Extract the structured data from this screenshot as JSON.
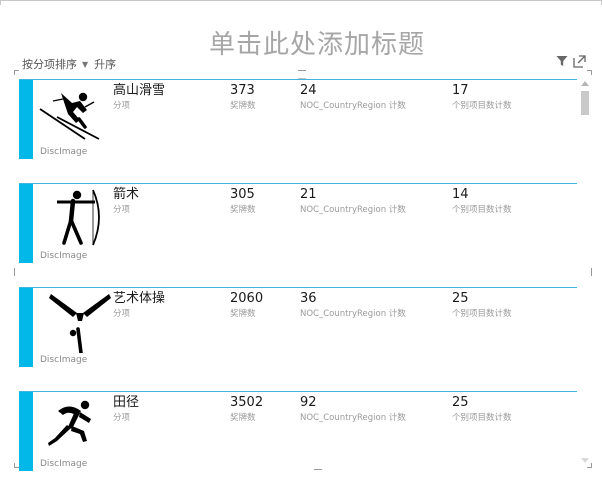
{
  "header": {
    "title": "单击此处添加标题",
    "sort": {
      "label": "按分项排序",
      "order": "升序"
    }
  },
  "icons": {
    "filter": "filter-icon",
    "focus_mode": "focus-mode-icon",
    "accent_color": "#01b8e8"
  },
  "cards": [
    {
      "image_label": "DiscImage",
      "pictogram": "alpine-skiing-icon",
      "discipline": "高山滑雪",
      "discipline_label": "分项",
      "medals": "373",
      "medals_label": "奖牌数",
      "noc_count": "24",
      "noc_label": "NOC_CountryRegion 计数",
      "events": "17",
      "events_label": "个别项目数计数"
    },
    {
      "image_label": "DiscImage",
      "pictogram": "archery-icon",
      "discipline": "箭术",
      "discipline_label": "分项",
      "medals": "305",
      "medals_label": "奖牌数",
      "noc_count": "21",
      "noc_label": "NOC_CountryRegion 计数",
      "events": "14",
      "events_label": "个别项目数计数"
    },
    {
      "image_label": "DiscImage",
      "pictogram": "artistic-gymnastics-icon",
      "discipline": "艺术体操",
      "discipline_label": "分项",
      "medals": "2060",
      "medals_label": "奖牌数",
      "noc_count": "36",
      "noc_label": "NOC_CountryRegion 计数",
      "events": "25",
      "events_label": "个别项目数计数"
    },
    {
      "image_label": "DiscImage",
      "pictogram": "athletics-icon",
      "discipline": "田径",
      "discipline_label": "分项",
      "medals": "3502",
      "medals_label": "奖牌数",
      "noc_count": "92",
      "noc_label": "NOC_CountryRegion 计数",
      "events": "25",
      "events_label": "个别项目数计数"
    }
  ]
}
